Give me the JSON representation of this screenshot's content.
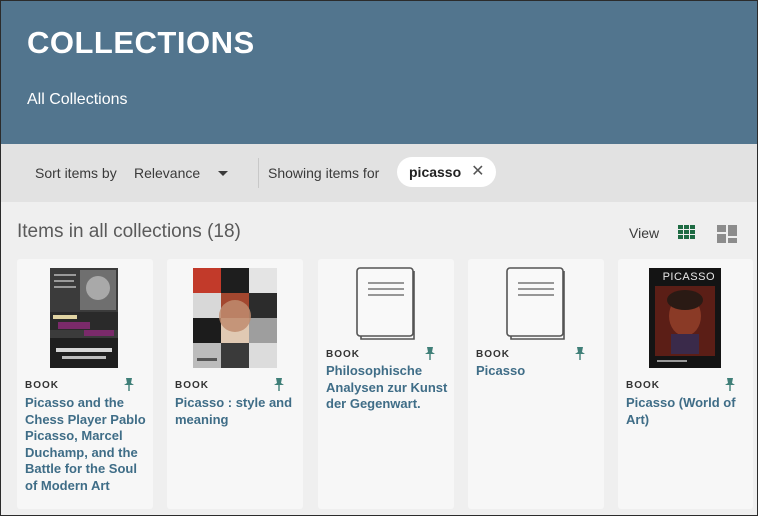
{
  "header": {
    "title": "COLLECTIONS",
    "breadcrumb": "All Collections",
    "background_color": "#52758e"
  },
  "toolbar": {
    "sort_label": "Sort items by",
    "sort_value": "Relevance",
    "showing_label": "Showing items for",
    "filter_chip": "picasso"
  },
  "results": {
    "heading": "Items in all collections (18)",
    "view_label": "View",
    "active_view": "grid"
  },
  "items": [
    {
      "type": "BOOK",
      "title": "Picasso and the Chess Player Pablo Picasso, Marcel Duchamp, and the Battle for the Soul of Modern Art",
      "cover": "photo-cover",
      "pinned": true
    },
    {
      "type": "BOOK",
      "title": "Picasso : style and meaning",
      "cover": "photo-cover",
      "pinned": true
    },
    {
      "type": "BOOK",
      "title": "Philosophische Analysen zur Kunst der Gegenwart.",
      "cover": "placeholder-book-icon",
      "pinned": true
    },
    {
      "type": "BOOK",
      "title": "Picasso",
      "cover": "placeholder-book-icon",
      "pinned": true
    },
    {
      "type": "BOOK",
      "title": "Picasso (World of Art)",
      "cover": "photo-cover",
      "cover_text": "PICASSO",
      "pinned": true
    }
  ],
  "colors": {
    "link": "#3f6d87",
    "accent_view": "#1e6b43"
  }
}
